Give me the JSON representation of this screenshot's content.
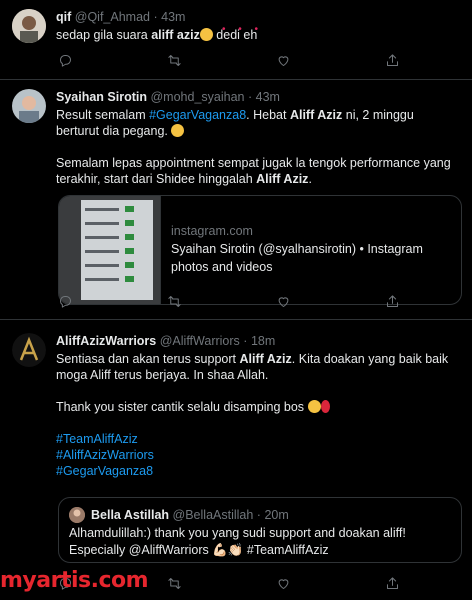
{
  "tweets": [
    {
      "display_name": "qif",
      "handle": "@Qif_Ahmad",
      "time": "43m",
      "text_pre": "sedap gila suara ",
      "text_bold": "aliff aziz",
      "text_post": " dedi eh",
      "more_indicator": "• • •"
    },
    {
      "display_name": "Syaihan Sirotin",
      "handle": "@mohd_syaihan",
      "time": "43m",
      "line1_pre": "Result semalam ",
      "line1_hashtag": "#GegarVaganza8",
      "line1_mid": ". Hebat ",
      "line1_bold": "Aliff Aziz",
      "line1_post": " ni, 2 minggu berturut dia pegang.",
      "para2_pre": "Semalam lepas appointment sempat jugak la tengok performance yang terakhir, start dari Shidee hinggalah ",
      "para2_bold": "Aliff Aziz",
      "para2_post": ".",
      "card": {
        "domain": "instagram.com",
        "title": "Syaihan Sirotin (@syalhansirotin) • Instagram photos and videos"
      }
    },
    {
      "display_name": "AliffAzizWarriors",
      "handle": "@AliffWarriors",
      "time": "18m",
      "line1_pre": "Sentiasa dan akan terus support ",
      "line1_bold": "Aliff Aziz",
      "line1_post": ". Kita doakan yang baik baik moga Aliff terus berjaya. In shaa Allah.",
      "line2": "Thank you sister cantik selalu disamping bos",
      "hashtags": [
        "#TeamAliffAziz",
        "#AliffAzizWarriors",
        "#GegarVaganza8"
      ],
      "quote": {
        "display_name": "Bella Astillah",
        "handle": "@BellaAstillah",
        "time": "20m",
        "text": "Alhamdulillah:) thank you yang sudi support and doakan aliff! Especially @AliffWarriors 💪🏻👏🏻 #TeamAliffAziz"
      }
    }
  ],
  "separator": "·",
  "icons": [
    "reply-icon",
    "retweet-icon",
    "like-icon",
    "share-icon"
  ],
  "watermark": "myartis.com",
  "colors": {
    "background": "#000000",
    "text": "#e7e9ea",
    "muted": "#71767b",
    "link": "#1d9bf0",
    "border": "#2f3336",
    "watermark": "#e6262e"
  }
}
